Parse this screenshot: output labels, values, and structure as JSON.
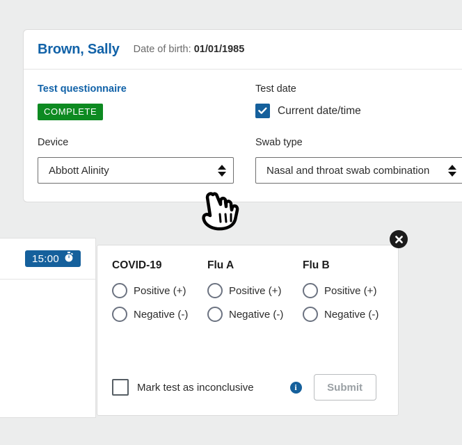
{
  "patient": {
    "name": "Brown, Sally",
    "dob_label": "Date of birth:",
    "dob_value": "01/01/1985"
  },
  "form": {
    "questionnaire_label": "Test questionnaire",
    "questionnaire_status": "COMPLETE",
    "test_date_label": "Test date",
    "current_datetime_label": "Current date/time",
    "device_label": "Device",
    "device_value": "Abbott Alinity",
    "swab_label": "Swab type",
    "swab_value": "Nasal and throat swab combination"
  },
  "timer": {
    "value": "15:00",
    "icon": "stopwatch-icon"
  },
  "results": {
    "close_icon": "close-icon",
    "columns": [
      {
        "title": "COVID-19",
        "options": [
          "Positive (+)",
          "Negative (-)"
        ]
      },
      {
        "title": "Flu A",
        "options": [
          "Positive (+)",
          "Negative (-)"
        ]
      },
      {
        "title": "Flu B",
        "options": [
          "Positive (+)",
          "Negative (-)"
        ]
      }
    ],
    "inconclusive_label": "Mark test as inconclusive",
    "info_icon": "info-icon",
    "info_glyph": "i",
    "submit_label": "Submit"
  },
  "colors": {
    "accent_blue": "#15609c",
    "link_blue": "#1162a8",
    "success_green": "#0d8a21",
    "page_background": "#eceded",
    "disabled_text": "#9aa0a4"
  },
  "cursor": {
    "icon": "pointing-hand-cursor"
  }
}
